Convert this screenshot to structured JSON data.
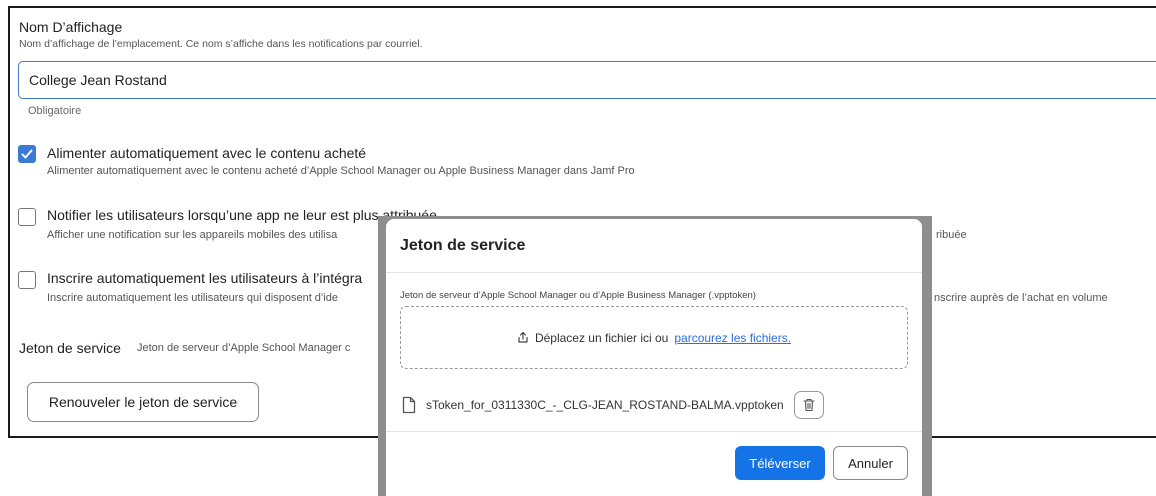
{
  "display_name": {
    "label": "Nom D’affichage",
    "help": "Nom d’affichage de l’emplacement. Ce nom s’affiche dans les notifications par courriel.",
    "value": "College Jean Rostand",
    "required": "Obligatoire"
  },
  "options": [
    {
      "checked": true,
      "title": "Alimenter automatiquement avec le contenu acheté",
      "description": "Alimenter automatiquement avec le contenu acheté d’Apple School Manager ou Apple Business Manager dans Jamf Pro"
    },
    {
      "checked": false,
      "title": "Notifier les utilisateurs lorsqu’une app ne leur est plus attribuée",
      "description": "Afficher une notification sur les appareils mobiles des utilisa",
      "description_tail": "ribuée"
    },
    {
      "checked": false,
      "title": "Inscrire automatiquement les utilisateurs à l’intégra",
      "description": "Inscrire automatiquement les utilisateurs qui disposent d’ide",
      "description_tail": "nscrire auprès de l’achat en volume"
    }
  ],
  "service_token": {
    "label": "Jeton de service",
    "help": "Jeton de serveur d’Apple School Manager c",
    "renew_button": "Renouveler le jeton de service"
  },
  "dialog": {
    "title": "Jeton de service",
    "dropzone_label": "Jeton de serveur d’Apple School Manager ou d’Apple Business Manager (.vpptoken)",
    "dropzone_text": "Déplacez un fichier ici ou",
    "browse_link": "parcourez les fichiers.",
    "file_name": "sToken_for_0311330C_-_CLG-JEAN_ROSTAND-BALMA.vpptoken",
    "upload_button": "Téléverser",
    "cancel_button": "Annuler"
  },
  "colors": {
    "accent": "#1473e6",
    "checkbox_checked": "#3a7bd5",
    "overlay": "#8e8e8e"
  }
}
